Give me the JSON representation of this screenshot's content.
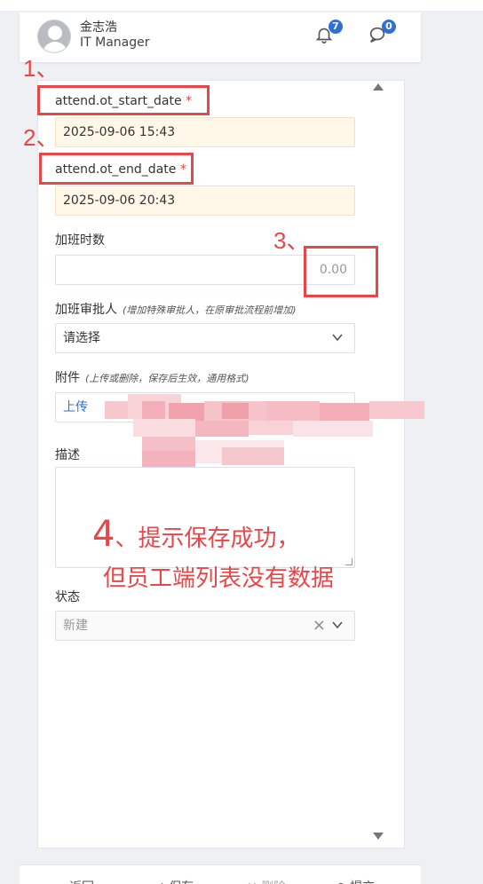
{
  "header": {
    "user_name": "金志浩",
    "user_role": "IT Manager",
    "notifications": {
      "icon": "bell-icon",
      "count": "7"
    },
    "messages": {
      "icon": "chat-icon",
      "count": "0"
    }
  },
  "form": {
    "ot_start": {
      "label": "attend.ot_start_date",
      "required": "*",
      "value": "2025-09-06 15:43"
    },
    "ot_end": {
      "label": "attend.ot_end_date",
      "required": "*",
      "value": "2025-09-06 20:43"
    },
    "ot_hours": {
      "label": "加班时数",
      "value": "0.00"
    },
    "approver": {
      "label": "加班审批人",
      "hint": "(增加特殊审批人，在原审批流程前增加)",
      "value": "请选择"
    },
    "attachment": {
      "label": "附件",
      "hint": "(上传或删除，保存后生效，通用格式)",
      "value": "上传"
    },
    "description": {
      "label": "描述",
      "value": ""
    },
    "status": {
      "label": "状态",
      "value": "新建"
    }
  },
  "annotations": {
    "marks": [
      "1、",
      "2、",
      "3、"
    ],
    "note_number": "4",
    "note_line1": "、提示保存成功，",
    "note_line2": "但员工端列表没有数据"
  },
  "footer": {
    "back": "返回",
    "save": "保存",
    "delete": "删除",
    "submit": "提交"
  },
  "colors": {
    "annotation_red": "#e8474a",
    "date_bg": "#fff8e8",
    "badge_blue": "#2f6fd6"
  }
}
